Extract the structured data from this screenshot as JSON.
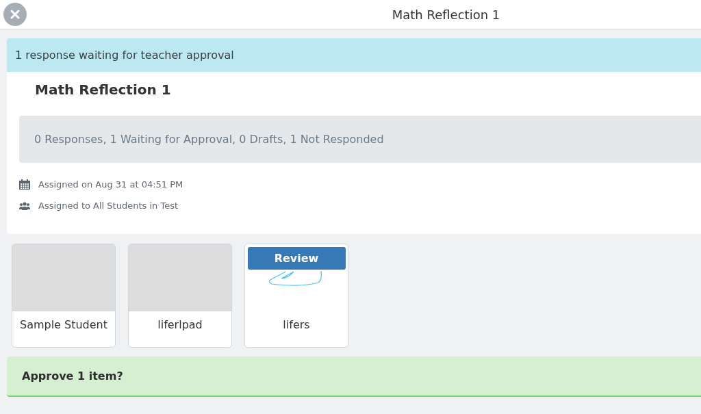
{
  "header": {
    "title": "Math Reflection 1"
  },
  "alert": "1 response waiting for teacher approval",
  "assignment": {
    "title": "Math Reflection 1",
    "summary": "0 Responses, 1 Waiting for Approval, 0 Drafts, 1 Not Responded",
    "assigned_on": "Assigned on Aug 31 at 04:51 PM",
    "assigned_to": "Assigned to All Students in Test"
  },
  "students": [
    {
      "name": "Sample Student",
      "kind": "empty"
    },
    {
      "name": "liferlpad",
      "kind": "empty"
    },
    {
      "name": "lifers",
      "kind": "response",
      "action": "Review"
    }
  ],
  "approval": "Approve 1 item?"
}
